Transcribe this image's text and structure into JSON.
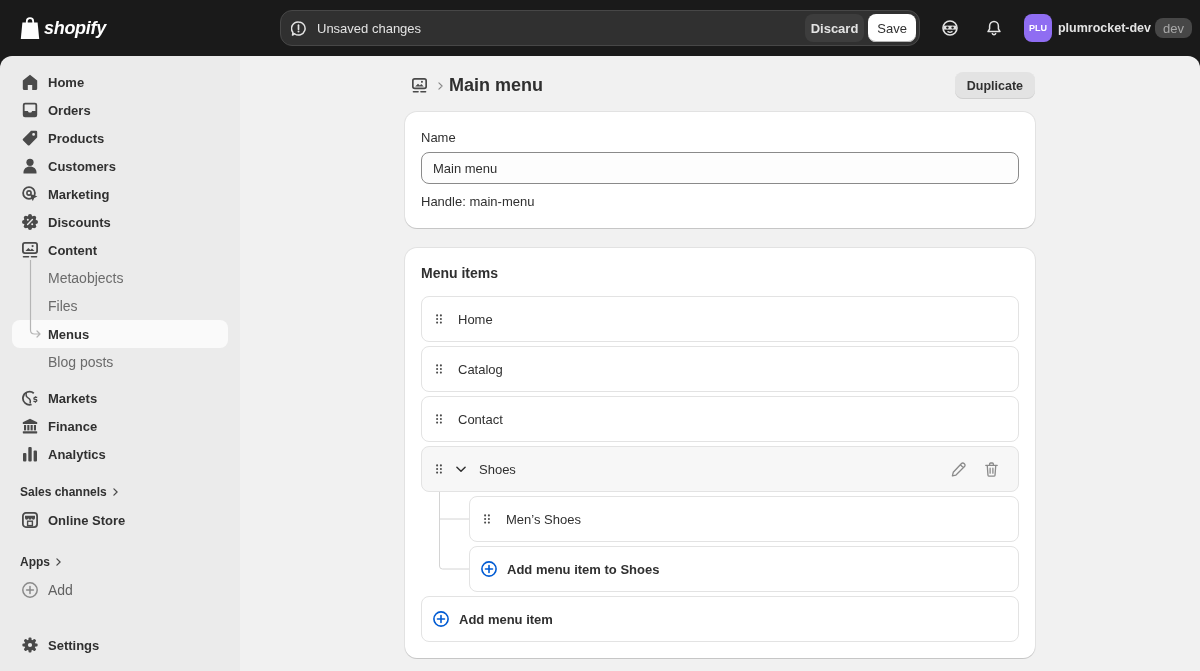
{
  "topbar": {
    "brand": "shopify",
    "notice": "Unsaved changes",
    "buttons": [
      {
        "label": "Discard",
        "kind": "secondary"
      },
      {
        "label": "Save",
        "kind": "primary"
      }
    ],
    "avatar": "PLU",
    "store": "plumrocket-dev",
    "badge": "dev"
  },
  "sidebar": {
    "items": [
      {
        "label": "Home",
        "kind": "home",
        "selected": false
      },
      {
        "label": "Orders",
        "kind": "orders",
        "selected": false
      },
      {
        "label": "Products",
        "kind": "products",
        "selected": false
      },
      {
        "label": "Customers",
        "kind": "customers",
        "selected": false
      },
      {
        "label": "Marketing",
        "kind": "marketing",
        "selected": false
      },
      {
        "label": "Discounts",
        "kind": "discounts",
        "selected": false
      },
      {
        "label": "Content",
        "kind": "content",
        "selected": false,
        "children": [
          {
            "label": "Metaobjects",
            "selected": false
          },
          {
            "label": "Files",
            "selected": false
          },
          {
            "label": "Menus",
            "selected": true
          },
          {
            "label": "Blog posts",
            "selected": false
          }
        ]
      },
      {
        "label": "Markets",
        "kind": "markets",
        "selected": false
      },
      {
        "label": "Finance",
        "kind": "finance",
        "selected": false
      },
      {
        "label": "Analytics",
        "kind": "analytics",
        "selected": false
      }
    ],
    "sections": [
      {
        "heading": "Sales channels",
        "items": [
          {
            "label": "Online Store",
            "kind": "store",
            "selected": false
          }
        ]
      },
      {
        "heading": "Apps",
        "items": [
          {
            "label": "Add",
            "kind": "add",
            "selected": false
          }
        ]
      }
    ],
    "footer": [
      {
        "label": "Settings",
        "kind": "settings",
        "selected": false
      }
    ]
  },
  "page": {
    "title": "Main menu",
    "action": "Duplicate"
  },
  "name_card": {
    "label": "Name",
    "value": "Main menu",
    "handle": "Handle: main-menu"
  },
  "menu_items": {
    "title": "Menu items",
    "items": [
      {
        "label": "Home",
        "hovered": false
      },
      {
        "label": "Catalog",
        "hovered": false
      },
      {
        "label": "Contact",
        "hovered": false
      },
      {
        "label": "Shoes",
        "hovered": true,
        "expanded": true,
        "children": [
          {
            "label": "Men’s Shoes",
            "hovered": false
          }
        ],
        "add_child": "Add menu item to Shoes"
      }
    ],
    "add": "Add menu item"
  }
}
